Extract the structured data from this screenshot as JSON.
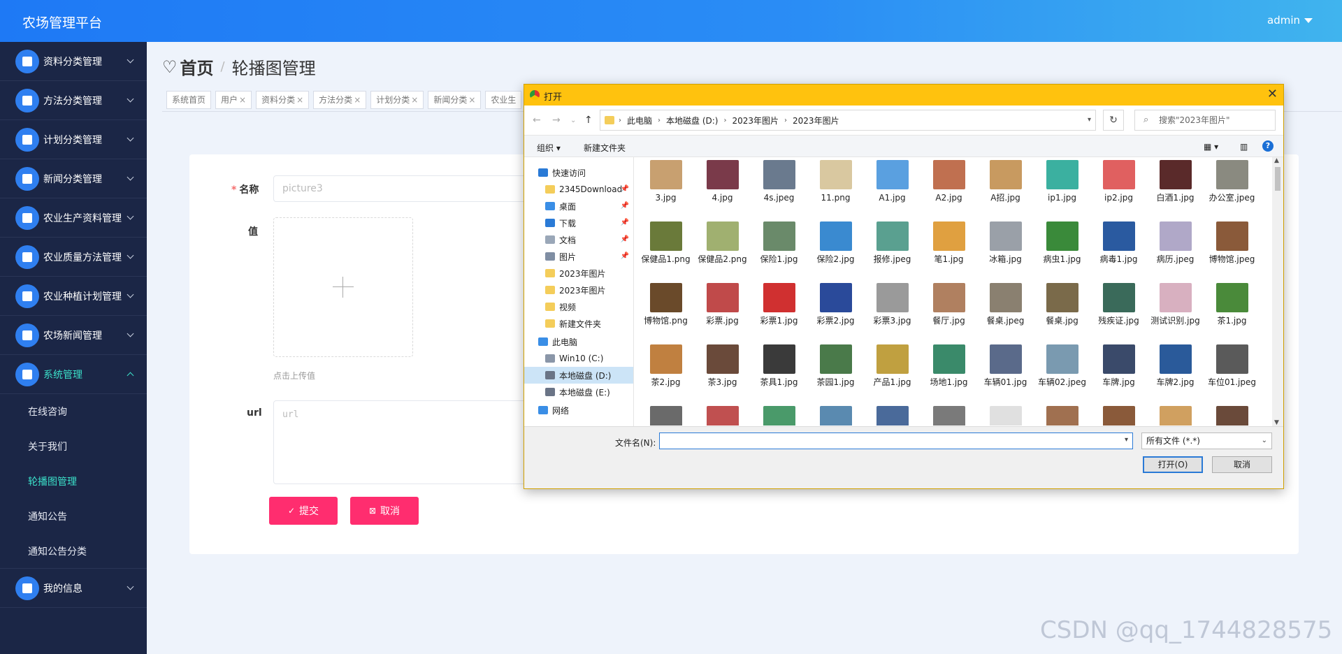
{
  "header": {
    "brand": "农场管理平台",
    "user": "admin"
  },
  "sidebar": {
    "menus": [
      {
        "label": "资料分类管理"
      },
      {
        "label": "方法分类管理"
      },
      {
        "label": "计划分类管理"
      },
      {
        "label": "新闻分类管理"
      },
      {
        "label": "农业生产资料管理"
      },
      {
        "label": "农业质量方法管理"
      },
      {
        "label": "农业种植计划管理"
      },
      {
        "label": "农场新闻管理"
      },
      {
        "label": "系统管理"
      },
      {
        "label": "我的信息"
      }
    ],
    "submenu": [
      "在线咨询",
      "关于我们",
      "轮播图管理",
      "通知公告",
      "通知公告分类"
    ]
  },
  "breadcrumb": {
    "home": "首页",
    "sep": "/",
    "current": "轮播图管理"
  },
  "tabs": [
    "系统首页",
    "用户",
    "资料分类",
    "方法分类",
    "计划分类",
    "新闻分类",
    "农业生"
  ],
  "form": {
    "name_label": "名称",
    "name_value": "picture3",
    "value_label": "值",
    "upload_hint": "点击上传值",
    "url_label": "url",
    "url_placeholder": "url",
    "submit": "提交",
    "cancel": "取消"
  },
  "dialog": {
    "title": "打开",
    "path": [
      "此电脑",
      "本地磁盘 (D:)",
      "2023年图片",
      "2023年图片"
    ],
    "search_placeholder": "搜索\"2023年图片\"",
    "toolbar": {
      "organize": "组织",
      "new_folder": "新建文件夹"
    },
    "tree": [
      {
        "label": "快速访问",
        "indent": 20,
        "color": "#2a7ad6",
        "pin": false
      },
      {
        "label": "2345Download",
        "indent": 30,
        "color": "#f4cd5a",
        "pin": true
      },
      {
        "label": "桌面",
        "indent": 30,
        "color": "#3a8ee6",
        "pin": true
      },
      {
        "label": "下载",
        "indent": 30,
        "color": "#2a7ad6",
        "pin": true
      },
      {
        "label": "文档",
        "indent": 30,
        "color": "#9aa7b8",
        "pin": true
      },
      {
        "label": "图片",
        "indent": 30,
        "color": "#7f8ea3",
        "pin": true
      },
      {
        "label": "2023年图片",
        "indent": 30,
        "color": "#f4cd5a",
        "pin": false
      },
      {
        "label": "2023年图片",
        "indent": 30,
        "color": "#f4cd5a",
        "pin": false
      },
      {
        "label": "视频",
        "indent": 30,
        "color": "#f4cd5a",
        "pin": false
      },
      {
        "label": "新建文件夹",
        "indent": 30,
        "color": "#f4cd5a",
        "pin": false
      },
      {
        "label": "此电脑",
        "indent": 20,
        "color": "#3a8ee6",
        "pin": false
      },
      {
        "label": "Win10 (C:)",
        "indent": 30,
        "color": "#8a96a8",
        "pin": false
      },
      {
        "label": "本地磁盘 (D:)",
        "indent": 30,
        "color": "#6a7486",
        "pin": false,
        "selected": true
      },
      {
        "label": "本地磁盘 (E:)",
        "indent": 30,
        "color": "#6a7486",
        "pin": false
      },
      {
        "label": "网络",
        "indent": 20,
        "color": "#3a8ee6",
        "pin": false
      }
    ],
    "files": [
      {
        "name": "3.jpg",
        "color": "#c8a070"
      },
      {
        "name": "4.jpg",
        "color": "#7a3a4a"
      },
      {
        "name": "4s.jpeg",
        "color": "#6a7a8e"
      },
      {
        "name": "11.png",
        "color": "#d9c8a0"
      },
      {
        "name": "A1.jpg",
        "color": "#5aa0e0"
      },
      {
        "name": "A2.jpg",
        "color": "#c07050"
      },
      {
        "name": "A招.jpg",
        "color": "#c89a60"
      },
      {
        "name": "ip1.jpg",
        "color": "#3bb0a0"
      },
      {
        "name": "ip2.jpg",
        "color": "#e06060"
      },
      {
        "name": "白酒1.jpg",
        "color": "#5a2a2a"
      },
      {
        "name": "办公室.jpeg",
        "color": "#8a8a80"
      },
      {
        "name": "保健品1.png",
        "color": "#6a7a3a"
      },
      {
        "name": "保健品2.png",
        "color": "#a0b070"
      },
      {
        "name": "保险1.jpg",
        "color": "#6a8a6a"
      },
      {
        "name": "保险2.jpg",
        "color": "#3a8ad0"
      },
      {
        "name": "报修.jpeg",
        "color": "#5aa090"
      },
      {
        "name": "笔1.jpg",
        "color": "#e0a040"
      },
      {
        "name": "冰箱.jpg",
        "color": "#9aa0a8"
      },
      {
        "name": "病虫1.jpg",
        "color": "#3a8a3a"
      },
      {
        "name": "病毒1.jpg",
        "color": "#2a5aa0"
      },
      {
        "name": "病历.jpeg",
        "color": "#b0a8c8"
      },
      {
        "name": "博物馆.jpeg",
        "color": "#8a5a3a"
      },
      {
        "name": "博物馆.png",
        "color": "#6a4a2a"
      },
      {
        "name": "彩票.jpg",
        "color": "#c04a4a"
      },
      {
        "name": "彩票1.jpg",
        "color": "#d03030"
      },
      {
        "name": "彩票2.jpg",
        "color": "#2a4a9a"
      },
      {
        "name": "彩票3.jpg",
        "color": "#9a9a9a"
      },
      {
        "name": "餐厅.jpg",
        "color": "#b08060"
      },
      {
        "name": "餐桌.jpeg",
        "color": "#8a8070"
      },
      {
        "name": "餐桌.jpg",
        "color": "#7a6a4a"
      },
      {
        "name": "残疾证.jpg",
        "color": "#3a6a5a"
      },
      {
        "name": "测试识别.jpg",
        "color": "#d8b0c0"
      },
      {
        "name": "茶1.jpg",
        "color": "#4a8a3a"
      },
      {
        "name": "茶2.jpg",
        "color": "#c08040"
      },
      {
        "name": "茶3.jpg",
        "color": "#6a4a3a"
      },
      {
        "name": "茶具1.jpg",
        "color": "#3a3a3a"
      },
      {
        "name": "茶园1.jpg",
        "color": "#4a7a4a"
      },
      {
        "name": "产品1.jpg",
        "color": "#c0a040"
      },
      {
        "name": "场地1.jpg",
        "color": "#3a8a6a"
      },
      {
        "name": "车辆01.jpg",
        "color": "#5a6a8a"
      },
      {
        "name": "车辆02.jpeg",
        "color": "#7a9ab0"
      },
      {
        "name": "车牌.jpg",
        "color": "#3a4a6a"
      },
      {
        "name": "车牌2.jpg",
        "color": "#2a5a9a"
      },
      {
        "name": "车位01.jpeg",
        "color": "#5a5a5a"
      },
      {
        "name": "",
        "color": "#6a6a6a"
      },
      {
        "name": "",
        "color": "#c05050"
      },
      {
        "name": "",
        "color": "#4a9a6a"
      },
      {
        "name": "",
        "color": "#5a8ab0"
      },
      {
        "name": "",
        "color": "#4a6a9a"
      },
      {
        "name": "",
        "color": "#7a7a7a"
      },
      {
        "name": "",
        "color": "#e0e0e0"
      },
      {
        "name": "",
        "color": "#a07050"
      },
      {
        "name": "",
        "color": "#8a5a3a"
      },
      {
        "name": "",
        "color": "#d0a060"
      },
      {
        "name": "",
        "color": "#6a4a3a"
      }
    ],
    "filename_label": "文件名(N):",
    "filetype": "所有文件 (*.*)",
    "open_button": "打开(O)",
    "cancel_button": "取消"
  },
  "watermark": "CSDN @qq_1744828575"
}
